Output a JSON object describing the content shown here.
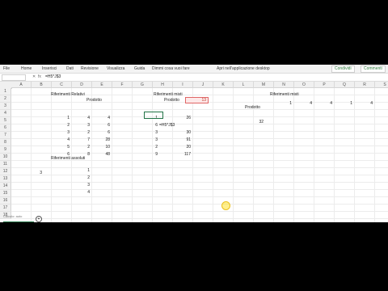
{
  "ribbon": {
    "tabs": [
      "File",
      "Home",
      "Inserisci",
      "Dati",
      "Revisione",
      "Visualizza",
      "Guida",
      "Dimmi cosa vuoi fare",
      "Apri nell'applicazione desktop"
    ],
    "share_label": "Condividi",
    "comments_label": "Commenti"
  },
  "formula_bar": {
    "namebox": "",
    "fx_symbol": "fx",
    "formula": "=H5*J$3"
  },
  "columns": [
    "A",
    "B",
    "C",
    "D",
    "E",
    "F",
    "G",
    "H",
    "I",
    "J",
    "K",
    "L",
    "M",
    "N",
    "O",
    "P",
    "Q",
    "R",
    "S"
  ],
  "rows": [
    "1",
    "2",
    "3",
    "4",
    "5",
    "6",
    "7",
    "8",
    "9",
    "10",
    "11",
    "12",
    "13",
    "14",
    "15",
    "16",
    "17",
    "18"
  ],
  "cells": {
    "rel_title": "Riferimenti Relativi",
    "rel_prodotto": "Prodotto",
    "rel_c": [
      "1",
      "2",
      "3",
      "4",
      "5",
      "6"
    ],
    "rel_d": [
      "4",
      "3",
      "2",
      "7",
      "2",
      "8"
    ],
    "rel_e": [
      "4",
      "6",
      "6",
      "28",
      "10",
      "48"
    ],
    "misti_title": "Riferimenti misti",
    "misti_prodotto": "Prodotto",
    "misti_red_value": "13",
    "misti_h": [
      "1",
      "6",
      "3",
      "3",
      "2",
      "9"
    ],
    "misti_i": [
      "26",
      "=H5*J$3",
      "30",
      "91",
      "20",
      "117"
    ],
    "misti2_title": "Riferimenti misti",
    "misti2_row": [
      "1",
      "4",
      "4",
      "1",
      "4"
    ],
    "misti2_prodotto": "Prodotto",
    "misti2_value": "32",
    "ass_title": "Riferimenti assoluti",
    "ass_b": "3",
    "ass_c": [
      "1",
      "2",
      "3",
      "4"
    ]
  },
  "status": {
    "label": "Calcolo: auto"
  },
  "colors": {
    "excel_green": "#217346",
    "red_border": "#e06666",
    "cursor_highlight": "#ffdc00"
  }
}
